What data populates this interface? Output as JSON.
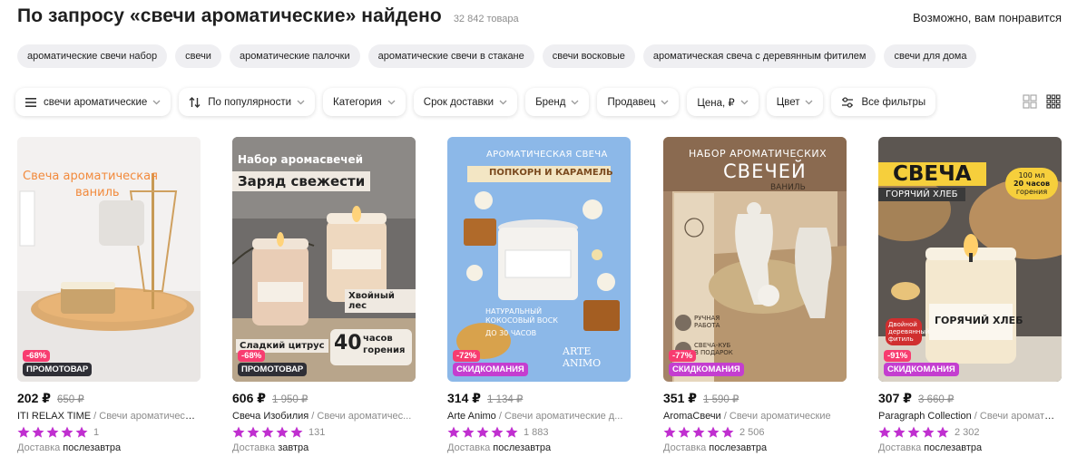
{
  "header": {
    "title": "По запросу «свечи ароматические» найдено",
    "count": "32 842 товара",
    "maybe_like": "Возможно, вам понравится"
  },
  "chips": [
    "ароматические свечи набор",
    "свечи",
    "ароматические палочки",
    "ароматические свечи в стакане",
    "свечи восковые",
    "ароматическая свеча с деревянным фитилем",
    "свечи для дома"
  ],
  "filters": {
    "category_select": "свечи ароматические",
    "sort": "По популярности",
    "category": "Категория",
    "delivery": "Срок доставки",
    "brand": "Бренд",
    "seller": "Продавец",
    "price": "Цена, ₽",
    "color": "Цвет",
    "all": "Все фильтры"
  },
  "products": [
    {
      "price": "202 ₽",
      "old_price": "650 ₽",
      "discount": "-68%",
      "tag": "ПРОМОТОВАР",
      "brand": "ITI RELAX TIME",
      "category": "Свечи ароматическа...",
      "rating_count": "1",
      "delivery_label": "Доставка",
      "delivery_day": "послезавтра",
      "img_text": {
        "line1": "Свеча ароматическая",
        "line2": "ваниль"
      }
    },
    {
      "price": "606 ₽",
      "old_price": "1 950 ₽",
      "discount": "-68%",
      "tag": "ПРОМОТОВАР",
      "brand": "Свеча Изобилия",
      "category": "Свечи ароматичес...",
      "rating_count": "131",
      "delivery_label": "Доставка",
      "delivery_day": "завтра",
      "img_text": {
        "top": "Набор аромасвечей",
        "head": "Заряд свежести",
        "side": "Хвойный лес",
        "bottom": "Сладкий цитрус",
        "hours_num": "40",
        "hours_a": "часов",
        "hours_b": "горения"
      }
    },
    {
      "price": "314 ₽",
      "old_price": "1 134 ₽",
      "discount": "-72%",
      "tag": "СКИДКОМАНИЯ",
      "brand": "Arte Animo",
      "category": "Свечи ароматические д...",
      "rating_count": "1 883",
      "delivery_label": "Доставка",
      "delivery_day": "послезавтра",
      "img_text": {
        "top": "АРОМАТИЧЕСКАЯ СВЕЧА",
        "ribbon": "ПОПКОРН И КАРАМЕЛЬ",
        "wax_a": "НАТУРАЛЬНЫЙ",
        "wax_b": "КОКОСОВЫЙ ВОСК",
        "hours": "ДО 30 ЧАСОВ",
        "logo": "ARTE ANIMO"
      }
    },
    {
      "price": "351 ₽",
      "old_price": "1 590 ₽",
      "discount": "-77%",
      "tag": "СКИДКОМАНИЯ",
      "brand": "AromaСвечи",
      "category": "Свечи ароматические",
      "rating_count": "2 506",
      "delivery_label": "Доставка",
      "delivery_day": "послезавтра",
      "img_text": {
        "top": "НАБОР АРОМАТИЧЕСКИХ",
        "head": "СВЕЧЕЙ",
        "sub": "ВАНИЛЬ",
        "note1": "РУЧНАЯ РАБОТА",
        "note2": "СВЕЧА-КУБ В ПОДАРОК"
      }
    },
    {
      "price": "307 ₽",
      "old_price": "3 660 ₽",
      "discount": "-91%",
      "tag": "СКИДКОМАНИЯ",
      "brand": "Paragraph Collection",
      "category": "Свечи ароматическ...",
      "rating_count": "2 302",
      "delivery_label": "Доставка",
      "delivery_day": "послезавтра",
      "img_text": {
        "head": "СВЕЧА",
        "sub": "ГОРЯЧИЙ ХЛЕБ",
        "badge_a": "100 мл",
        "badge_b": "20 часов",
        "badge_c": "горения",
        "label": "ГОРЯЧИЙ ХЛЕБ",
        "wick_a": "Двойной",
        "wick_b": "деревянный",
        "wick_c": "фитиль"
      }
    }
  ],
  "colors": {
    "star": "#c02fd0",
    "discount": "#f83c70",
    "promo_tag": "#2f2f36",
    "skid_tag": "#c43ed0"
  }
}
